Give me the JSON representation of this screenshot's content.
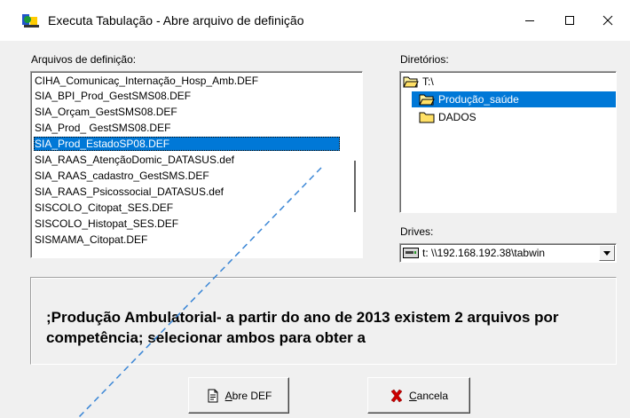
{
  "window": {
    "title": "Executa Tabulação - Abre arquivo de definição",
    "controls": [
      "minimize",
      "maximize",
      "close"
    ]
  },
  "files": {
    "label": "Arquivos de definição:",
    "items": [
      "CIHA_Comunicaç_Internação_Hosp_Amb.DEF",
      "SIA_BPI_Prod_GestSMS08.DEF",
      "SIA_Orçam_GestSMS08.DEF",
      "SIA_Prod_ GestSMS08.DEF",
      "SIA_Prod_EstadoSP08.DEF",
      "SIA_RAAS_AtençãoDomic_DATASUS.def",
      "SIA_RAAS_cadastro_GestSMS.DEF",
      "SIA_RAAS_Psicossocial_DATASUS.def",
      "SISCOLO_Citopat_SES.DEF",
      "SISCOLO_Histopat_SES.DEF",
      "SISMAMA_Citopat.DEF"
    ],
    "selected_index": 4
  },
  "directories": {
    "label": "Diretórios:",
    "items": [
      {
        "name": "T:\\",
        "icon": "folder-open-icon",
        "selected": false
      },
      {
        "name": "Produção_saúde",
        "icon": "folder-open-icon",
        "selected": true
      },
      {
        "name": "DADOS",
        "icon": "folder-icon",
        "selected": false
      }
    ]
  },
  "drives": {
    "label": "Drives:",
    "value": "t: \\\\192.168.192.38\\tabwin",
    "icon": "network-drive-icon"
  },
  "description": {
    "text": ";Produção Ambulatorial- a partir do ano de 2013 existem 2 arquivos por competência; selecionar ambos para obter a"
  },
  "buttons": {
    "open": {
      "mnemonic": "A",
      "rest": "bre DEF",
      "icon": "document-open-icon"
    },
    "cancel": {
      "mnemonic": "C",
      "rest": "ancela",
      "icon": "red-x-icon"
    }
  },
  "colors": {
    "selection": "#0078d7",
    "window_bg": "#f0f0f0",
    "dashed_line": "#3a86d6"
  }
}
